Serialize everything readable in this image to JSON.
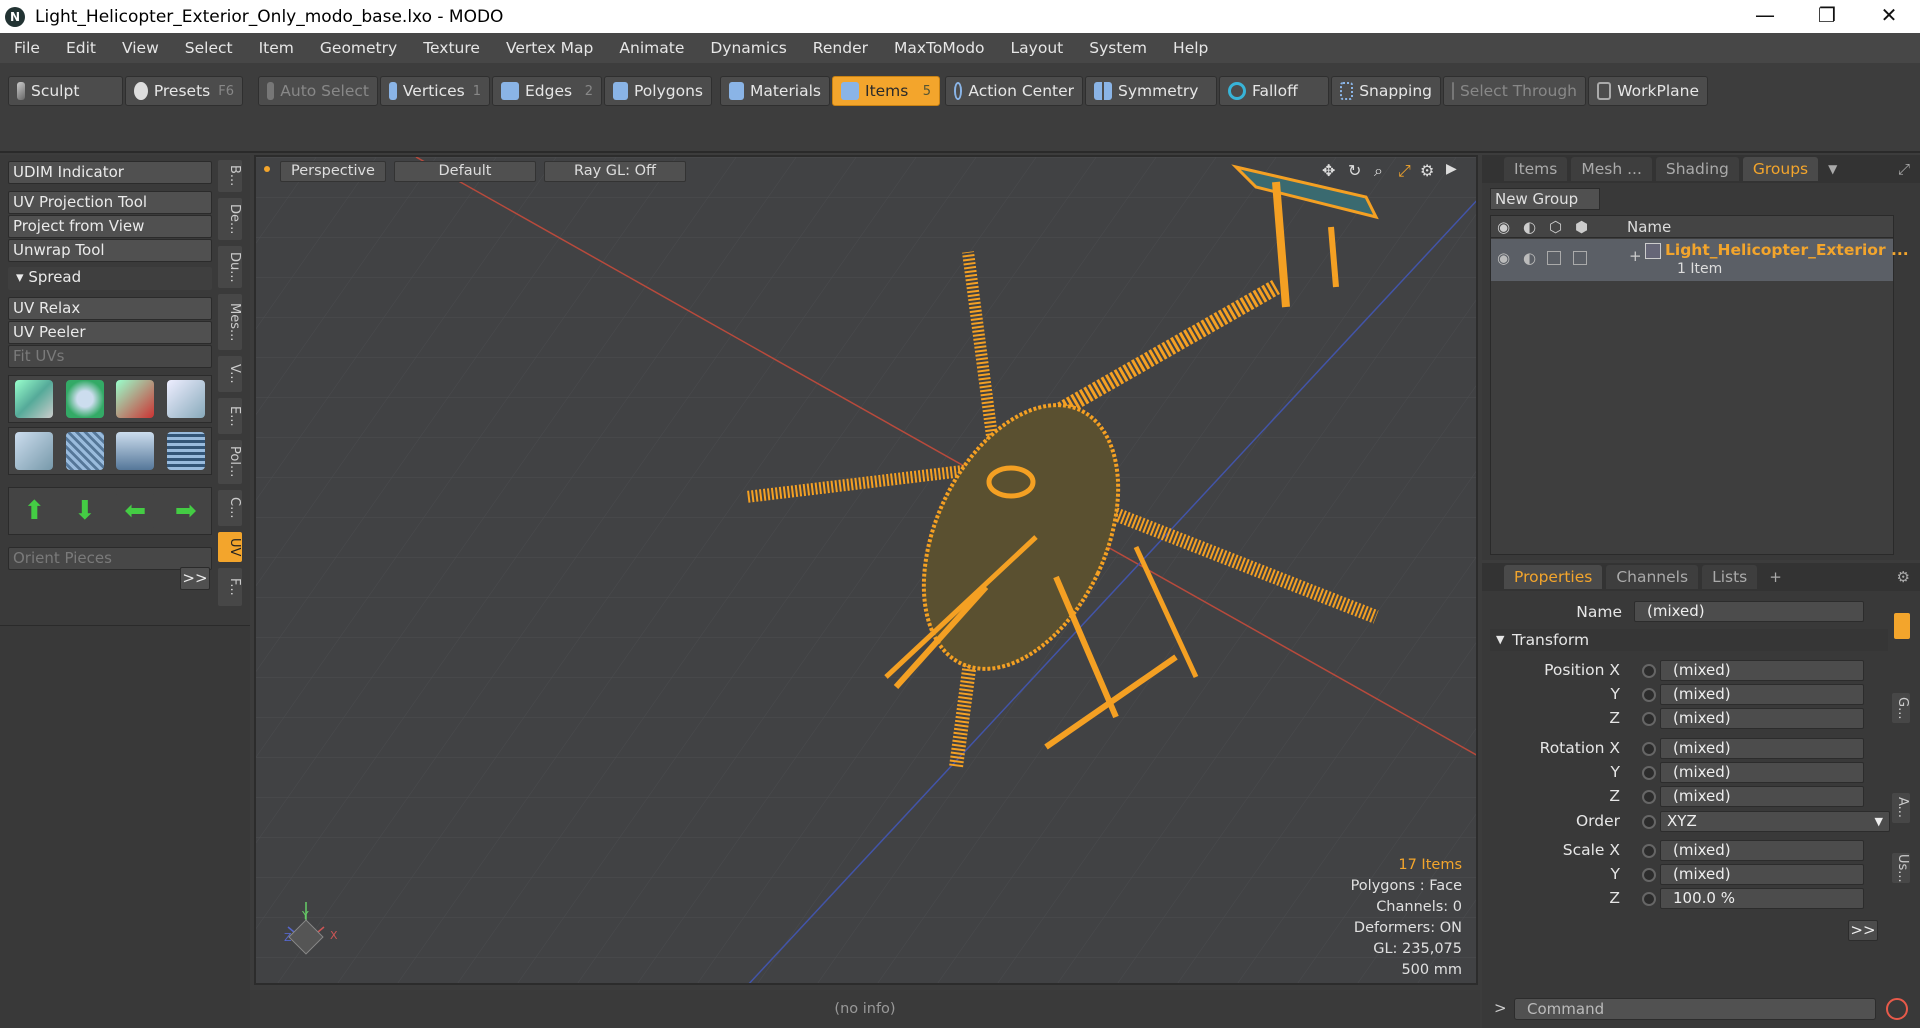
{
  "window": {
    "title": "Light_Helicopter_Exterior_Only_modo_base.lxo - MODO",
    "logo": "N",
    "minimize": "—",
    "restore": "❐",
    "close": "✕"
  },
  "menu": [
    "File",
    "Edit",
    "View",
    "Select",
    "Item",
    "Geometry",
    "Texture",
    "Vertex Map",
    "Animate",
    "Dynamics",
    "Render",
    "MaxToModo",
    "Layout",
    "System",
    "Help"
  ],
  "toolbar": {
    "sculpt": "Sculpt",
    "presets": "Presets",
    "presets_key": "F6",
    "auto_select": "Auto Select",
    "vertices": "Vertices",
    "vertices_key": "1",
    "edges": "Edges",
    "edges_key": "2",
    "polygons": "Polygons",
    "materials": "Materials",
    "items": "Items",
    "items_key": "5",
    "action_center": "Action Center",
    "symmetry": "Symmetry",
    "falloff": "Falloff",
    "snapping": "Snapping",
    "select_through": "Select Through",
    "workplane": "WorkPlane"
  },
  "left_panel": {
    "udim": "UDIM Indicator",
    "uv_projection": "UV Projection Tool",
    "project_from_view": "Project from View",
    "unwrap": "Unwrap Tool",
    "spread": "Spread",
    "uv_relax": "UV Relax",
    "uv_peeler": "UV Peeler",
    "fit_uvs": "Fit UVs",
    "orient_pieces": "Orient Pieces",
    "more": ">>",
    "vtabs": [
      "B...",
      "De...",
      "Du...",
      "Mes...",
      "V...",
      "E...",
      "Pol...",
      "C...",
      "UV",
      "F..."
    ]
  },
  "viewport": {
    "view_mode": "Perspective",
    "shading": "Default",
    "raygl": "Ray GL: Off",
    "info": {
      "items": "17 Items",
      "polygons": "Polygons : Face",
      "channels": "Channels: 0",
      "deformers": "Deformers: ON",
      "gl": "GL: 235,075",
      "scale": "500 mm"
    },
    "axis_y": "Y",
    "axis_x": "X",
    "axis_z": "Z"
  },
  "status": "(no info)",
  "right_top": {
    "tabs": [
      "Items",
      "Mesh ...",
      "Shading",
      "Groups"
    ],
    "new_group": "New Group",
    "col_name": "Name",
    "group_name": "Light_Helicopter_Exterior ...",
    "group_count": "1 Item"
  },
  "properties": {
    "tabs": [
      "Properties",
      "Channels",
      "Lists"
    ],
    "add_tab": "+",
    "name_label": "Name",
    "name_value": "(mixed)",
    "transform": "Transform",
    "pos_x_label": "Position X",
    "pos_x": "(mixed)",
    "pos_y_label": "Y",
    "pos_y": "(mixed)",
    "pos_z_label": "Z",
    "pos_z": "(mixed)",
    "rot_x_label": "Rotation X",
    "rot_x": "(mixed)",
    "rot_y_label": "Y",
    "rot_y": "(mixed)",
    "rot_z_label": "Z",
    "rot_z": "(mixed)",
    "order_label": "Order",
    "order": "XYZ",
    "scale_x_label": "Scale X",
    "scale_x": "(mixed)",
    "scale_y_label": "Y",
    "scale_y": "(mixed)",
    "scale_z_label": "Z",
    "scale_z": "100.0 %",
    "more": ">>",
    "side_tabs": [
      "G...",
      "A...",
      "Us..."
    ]
  },
  "command": {
    "prompt": ">",
    "placeholder": "Command"
  },
  "colors": {
    "accent": "#f3a52c",
    "wire": "#f4a023",
    "panel": "#3c3c3c",
    "viewport": "#414244"
  }
}
